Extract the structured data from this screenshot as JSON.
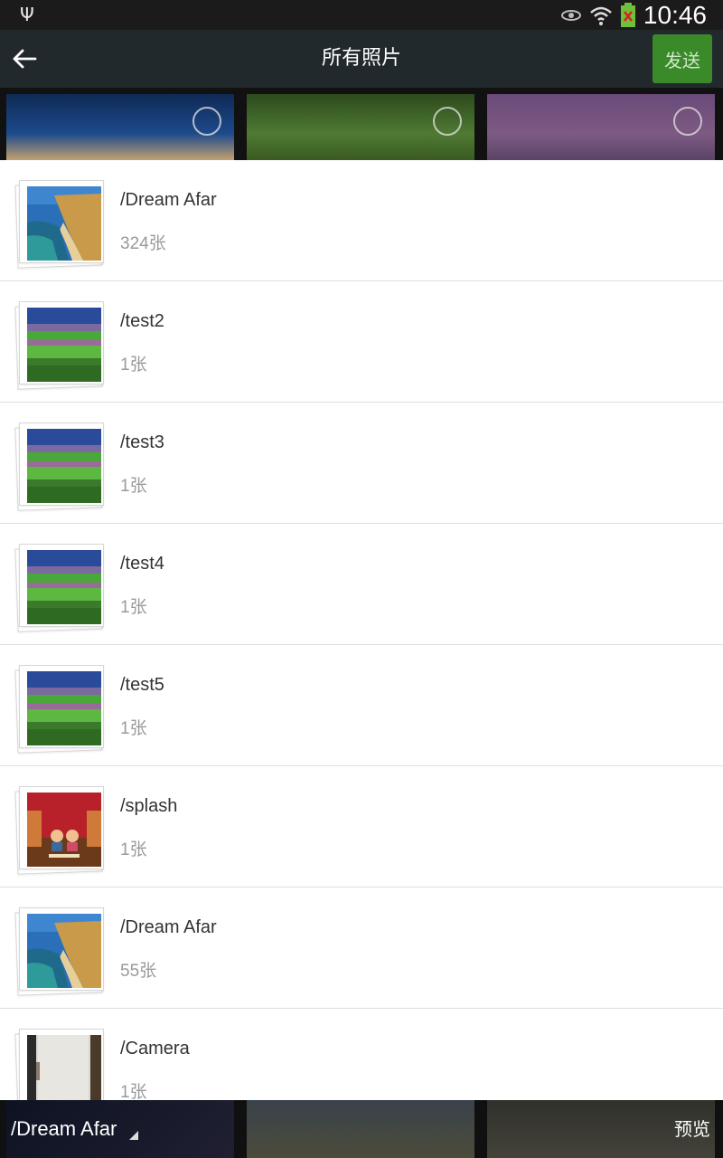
{
  "status": {
    "time": "10:46"
  },
  "header": {
    "title": "所有照片",
    "send_label": "发送"
  },
  "albums": [
    {
      "name": "/Dream Afar",
      "count": "324张",
      "thumb": "coast"
    },
    {
      "name": "/test2",
      "count": "1张",
      "thumb": "field"
    },
    {
      "name": "/test3",
      "count": "1张",
      "thumb": "field"
    },
    {
      "name": "/test4",
      "count": "1张",
      "thumb": "field"
    },
    {
      "name": "/test5",
      "count": "1张",
      "thumb": "field"
    },
    {
      "name": "/splash",
      "count": "1张",
      "thumb": "splash"
    },
    {
      "name": "/Dream Afar",
      "count": "55张",
      "thumb": "coast"
    },
    {
      "name": "/Camera",
      "count": "1张",
      "thumb": "camera"
    }
  ],
  "footer": {
    "folder_label": "/Dream Afar",
    "preview_label": "预览"
  },
  "colors": {
    "actionbar": "#22292c",
    "send_button": "#3a8a2a",
    "divider": "#dedede"
  }
}
